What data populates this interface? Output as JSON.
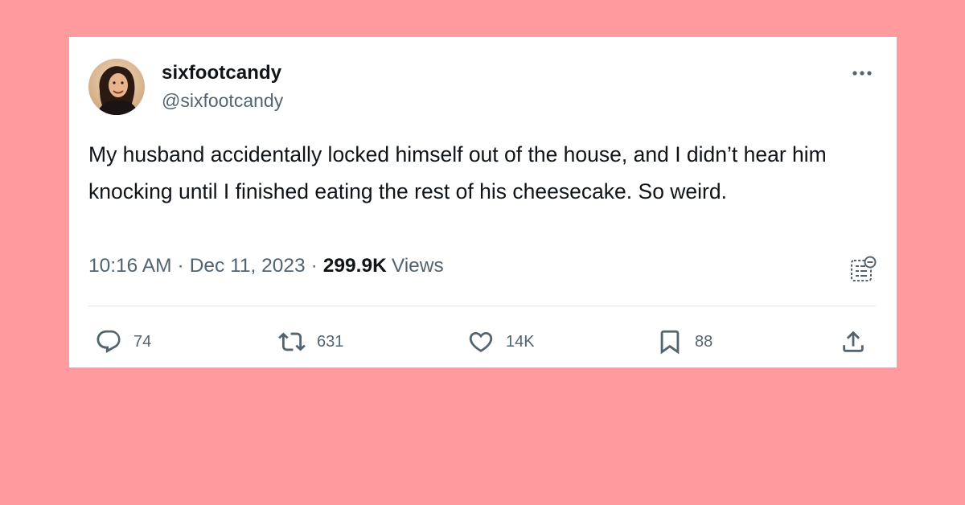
{
  "author": {
    "display_name": "sixfootcandy",
    "handle": "@sixfootcandy"
  },
  "tweet": {
    "text": "My husband accidentally locked himself out of the house, and I didn’t hear him knocking until I finished eating the rest of his cheesecake. So weird.",
    "time": "10:16 AM",
    "date": "Dec 11, 2023",
    "separator": "·",
    "views_count": "299.9K",
    "views_label": "Views"
  },
  "actions": {
    "replies": "74",
    "reposts": "631",
    "likes": "14K",
    "bookmarks": "88"
  },
  "icons": {
    "more": "more-horizontal-icon",
    "notes": "community-notes-icon",
    "reply": "reply-icon",
    "repost": "repost-icon",
    "like": "heart-icon",
    "bookmark": "bookmark-icon",
    "share": "share-icon"
  },
  "colors": {
    "page_background": "#ff9a9e",
    "card_background": "#ffffff",
    "primary_text": "#0f1419",
    "secondary_text": "#536471",
    "divider": "#e1e6ea"
  }
}
